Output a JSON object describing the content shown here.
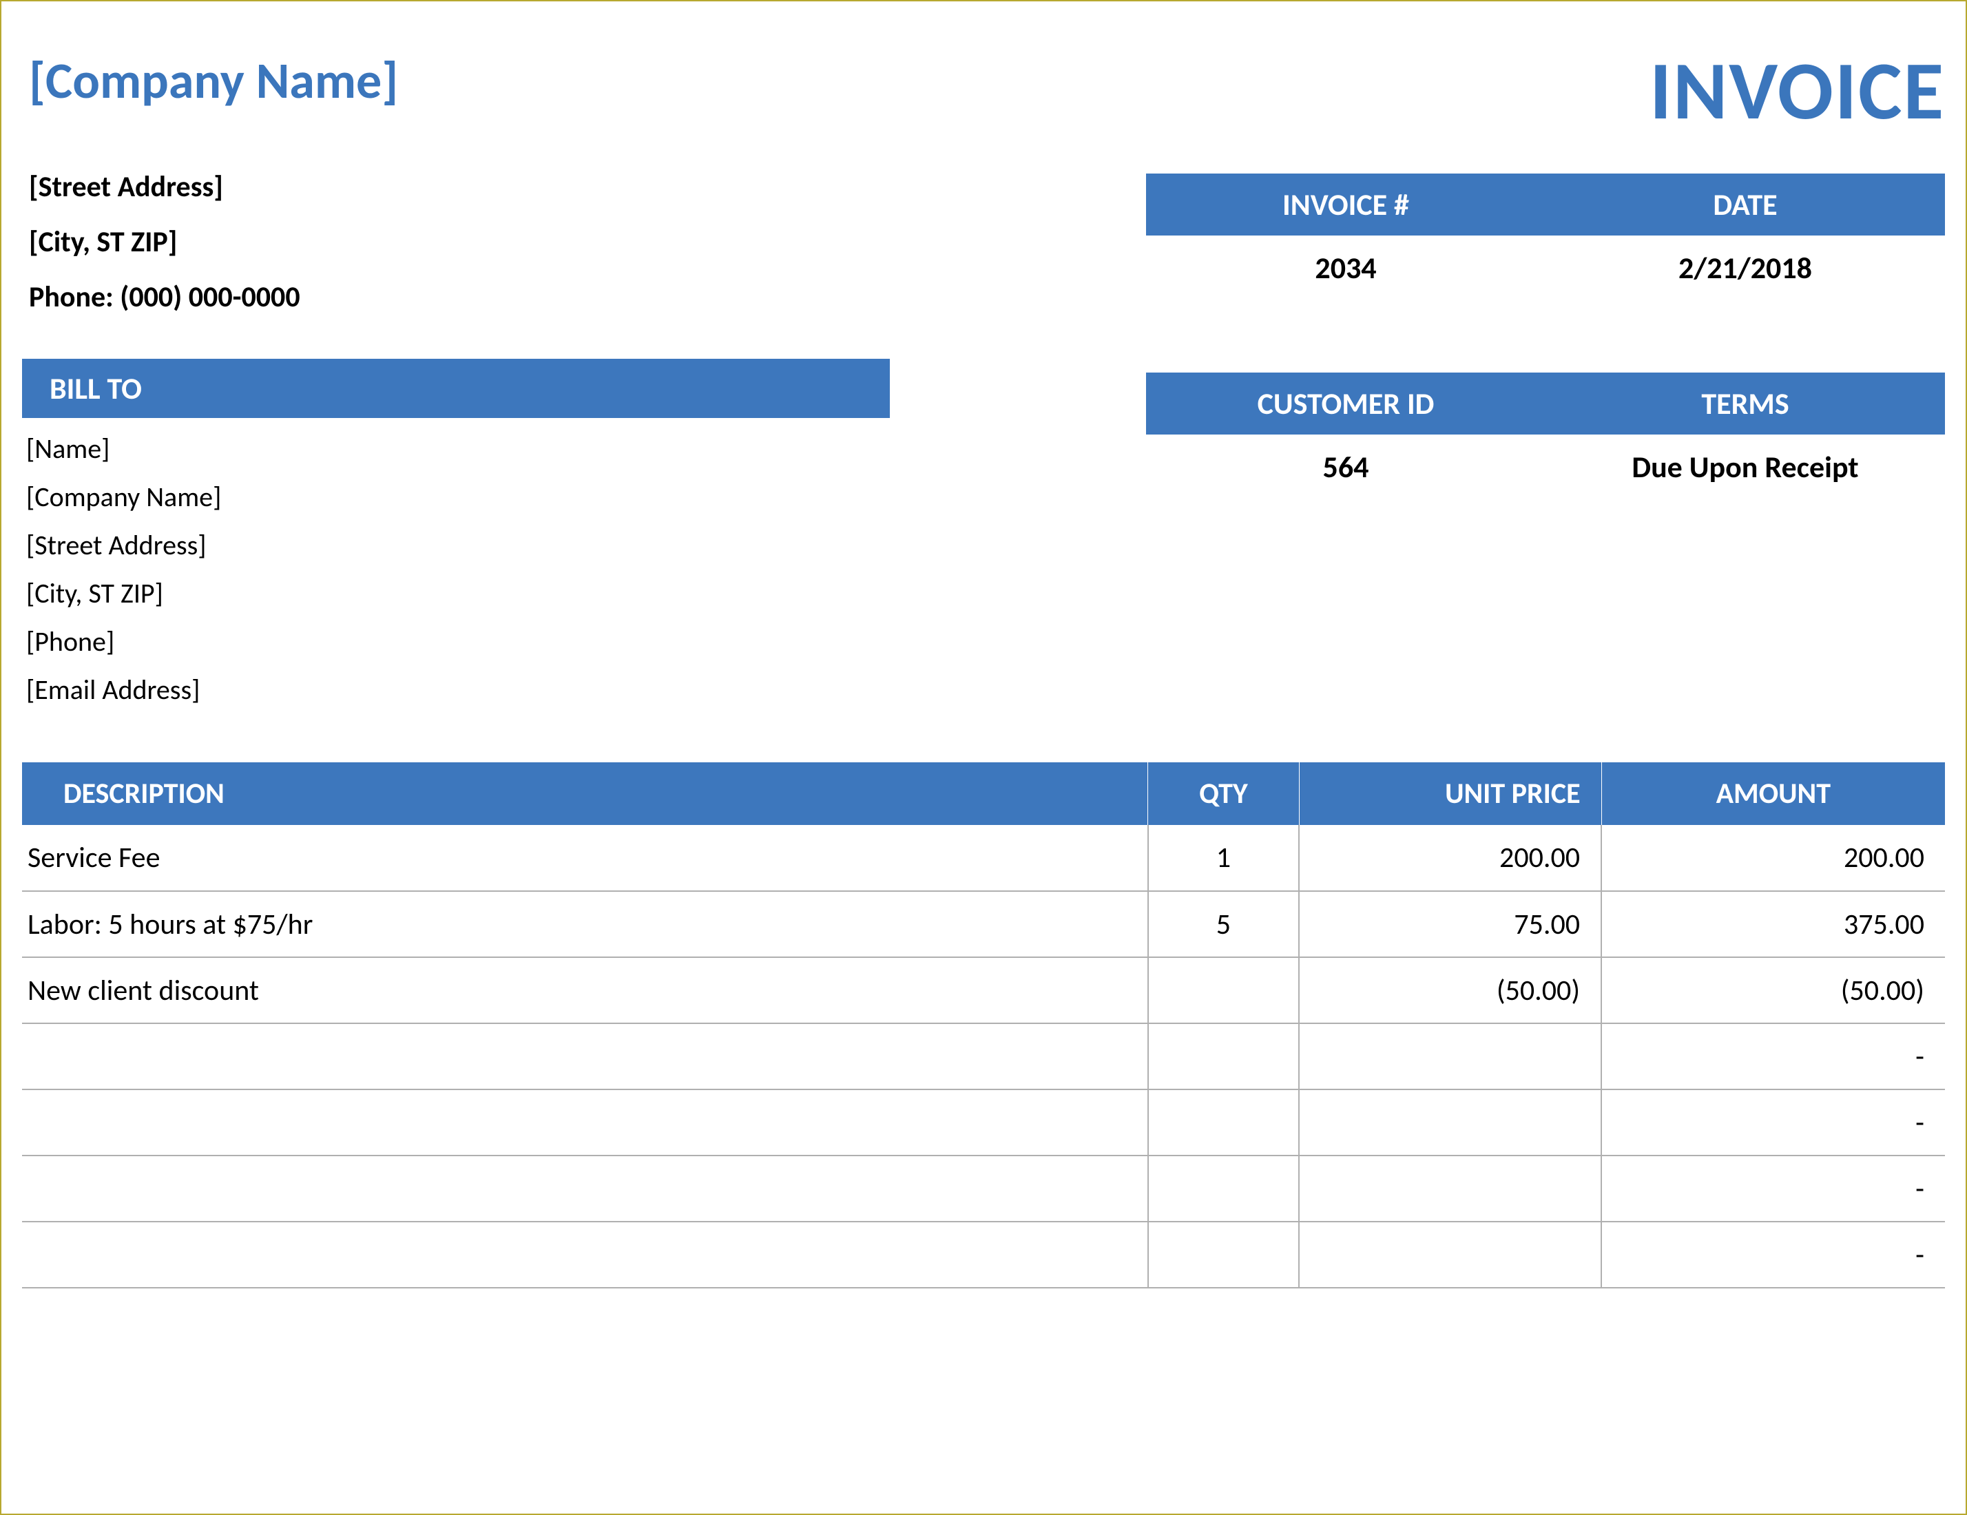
{
  "header": {
    "company_name": "[Company Name]",
    "invoice_title": "INVOICE",
    "street": "[Street Address]",
    "city_st_zip": "[City, ST  ZIP]",
    "phone": "Phone: (000) 000-0000"
  },
  "meta": {
    "invoice_number_label": "INVOICE #",
    "date_label": "DATE",
    "invoice_number": "2034",
    "date": "2/21/2018",
    "customer_id_label": "CUSTOMER ID",
    "terms_label": "TERMS",
    "customer_id": "564",
    "terms": "Due Upon Receipt"
  },
  "billto": {
    "header": "BILL TO",
    "name": "[Name]",
    "company": "[Company Name]",
    "street": "[Street Address]",
    "city_st_zip": "[City, ST  ZIP]",
    "phone": "[Phone]",
    "email": "[Email Address]"
  },
  "columns": {
    "description": "DESCRIPTION",
    "qty": "QTY",
    "unit_price": "UNIT PRICE",
    "amount": "AMOUNT"
  },
  "rows": [
    {
      "description": "Service Fee",
      "qty": "1",
      "unit_price": "200.00",
      "amount": "200.00"
    },
    {
      "description": "Labor: 5 hours at $75/hr",
      "qty": "5",
      "unit_price": "75.00",
      "amount": "375.00"
    },
    {
      "description": "New client discount",
      "qty": "",
      "unit_price": "(50.00)",
      "amount": "(50.00)"
    },
    {
      "description": "",
      "qty": "",
      "unit_price": "",
      "amount": "-"
    },
    {
      "description": "",
      "qty": "",
      "unit_price": "",
      "amount": "-"
    },
    {
      "description": "",
      "qty": "",
      "unit_price": "",
      "amount": "-"
    },
    {
      "description": "",
      "qty": "",
      "unit_price": "",
      "amount": "-"
    }
  ]
}
